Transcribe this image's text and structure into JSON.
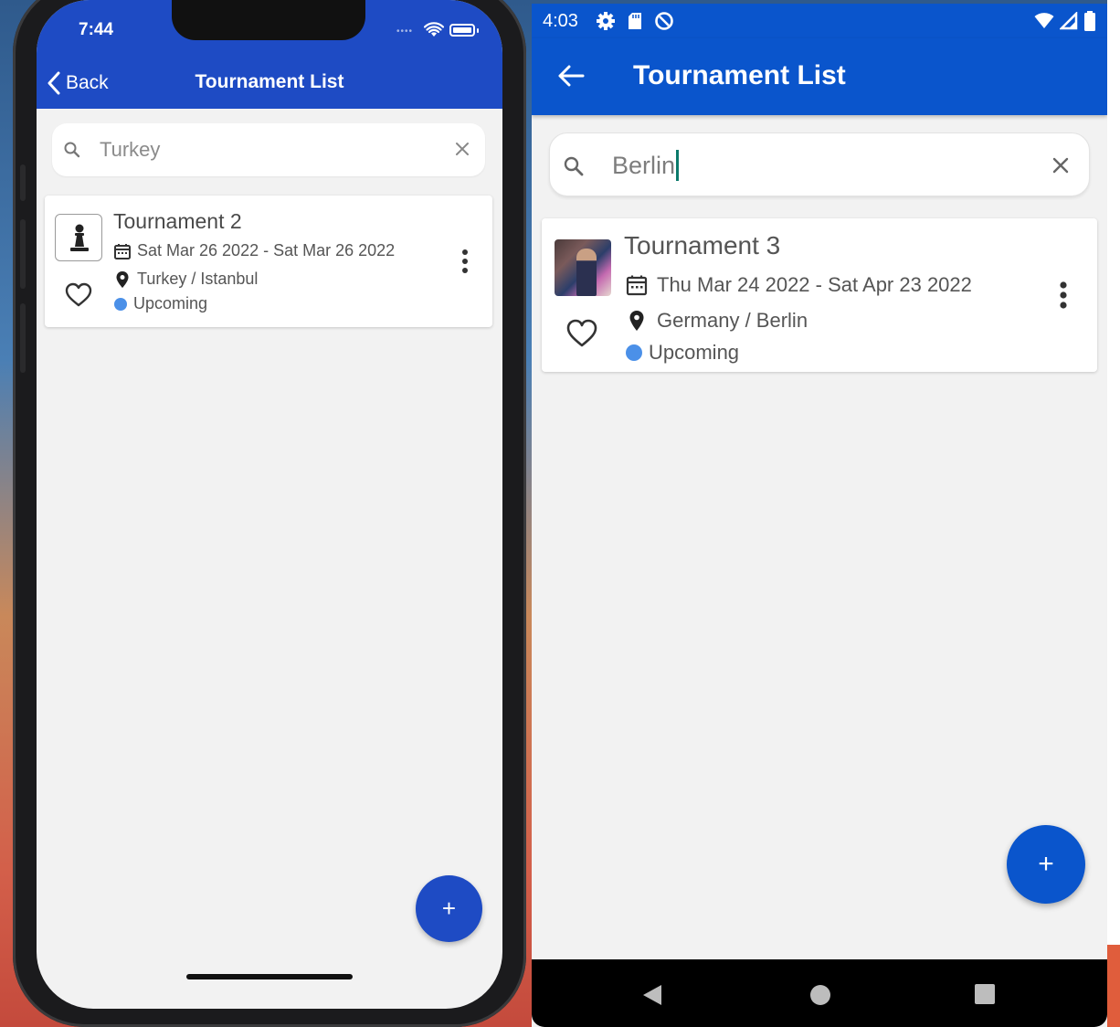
{
  "ios": {
    "status_time": "7:44",
    "nav": {
      "back_label": "Back",
      "title": "Tournament List"
    },
    "search": {
      "value": "Turkey"
    },
    "card": {
      "title": "Tournament 2",
      "date_range": "Sat Mar 26 2022 - Sat Mar 26 2022",
      "location": "Turkey / Istanbul",
      "status": "Upcoming",
      "thumbnail_icon": "chess-pawn-icon"
    },
    "fab_label": "+"
  },
  "android": {
    "status_time": "4:03",
    "status_icons": [
      "settings-icon",
      "sd-card-icon",
      "do-not-disturb-icon",
      "wifi-icon",
      "signal-icon",
      "battery-icon"
    ],
    "appbar": {
      "title": "Tournament List"
    },
    "search": {
      "value": "Berlin"
    },
    "card": {
      "title": "Tournament 3",
      "date_range": "Thu Mar 24 2022 - Sat Apr 23 2022",
      "location": "Germany / Berlin",
      "status": "Upcoming",
      "thumbnail": "photo"
    },
    "fab_label": "+",
    "nav_buttons": [
      "back-nav-icon",
      "home-nav-icon",
      "recents-nav-icon"
    ]
  },
  "colors": {
    "ios_primary": "#1e4bc4",
    "android_primary": "#0a55cc",
    "status_upcoming": "#4b90e8",
    "background": "#f2f2f2"
  }
}
